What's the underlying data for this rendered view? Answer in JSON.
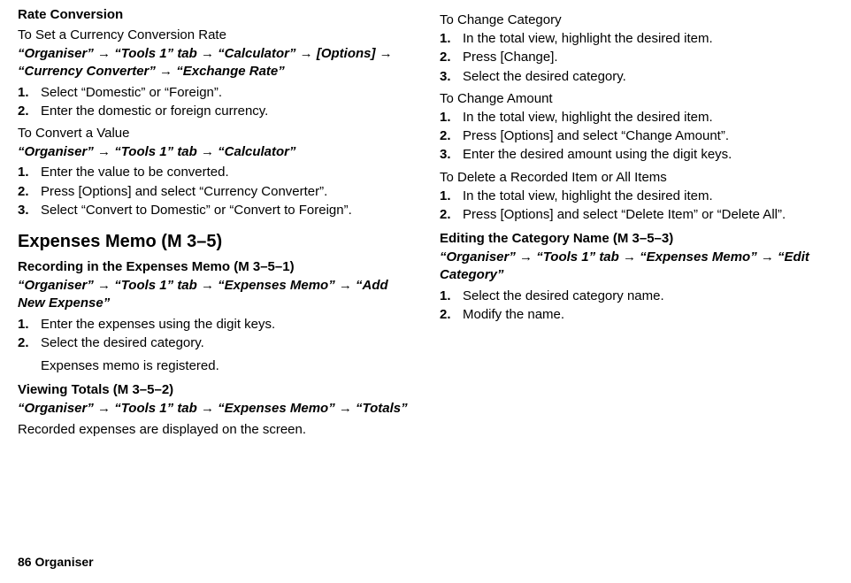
{
  "col1": {
    "rateConversion": {
      "title": "Rate Conversion",
      "setRate": {
        "heading": "To Set a Currency Conversion Rate",
        "path": "“Organiser” → “Tools 1” tab → “Calculator” → [Options] → “Currency Converter” → “Exchange Rate”",
        "steps": [
          "Select “Domestic” or “Foreign”.",
          "Enter the domestic or foreign currency."
        ]
      },
      "convertValue": {
        "heading": "To Convert a Value",
        "path": "“Organiser” → “Tools 1” tab → “Calculator”",
        "steps": [
          "Enter the value to be converted.",
          "Press [Options] and select “Currency Converter”.",
          "Select “Convert to Domestic” or “Convert to Foreign”."
        ]
      }
    },
    "expensesMemo": {
      "title": "Expenses Memo (M 3–5)",
      "recording": {
        "heading": "Recording in the Expenses Memo (M 3–5–1)",
        "path": "“Organiser” → “Tools 1” tab → “Expenses Memo” → “Add New Expense”",
        "steps": [
          "Enter the expenses using the digit keys.",
          "Select the desired category."
        ],
        "note": "Expenses memo is registered."
      },
      "viewingTotals": {
        "heading": "Viewing Totals (M 3–5–2)",
        "path": "“Organiser” → “Tools 1” tab → “Expenses Memo” → “Totals”",
        "text": "Recorded expenses are displayed on the screen."
      }
    }
  },
  "col2": {
    "changeCategory": {
      "heading": "To Change Category",
      "steps": [
        "In the total view, highlight the desired item.",
        "Press [Change].",
        "Select the desired category."
      ]
    },
    "changeAmount": {
      "heading": "To Change Amount",
      "steps": [
        "In the total view, highlight the desired item.",
        "Press [Options] and select “Change Amount”.",
        "Enter the desired amount using the digit keys."
      ]
    },
    "deleteItem": {
      "heading": "To Delete a Recorded Item or All Items",
      "steps": [
        "In the total view, highlight the desired item.",
        "Press [Options] and select “Delete Item” or “Delete All”."
      ]
    },
    "editCategory": {
      "heading": "Editing the Category Name (M 3–5–3)",
      "path": "“Organiser” → “Tools 1” tab → “Expenses Memo” → “Edit Category”",
      "steps": [
        "Select the desired category name.",
        "Modify the name."
      ]
    }
  },
  "footer": "86    Organiser"
}
